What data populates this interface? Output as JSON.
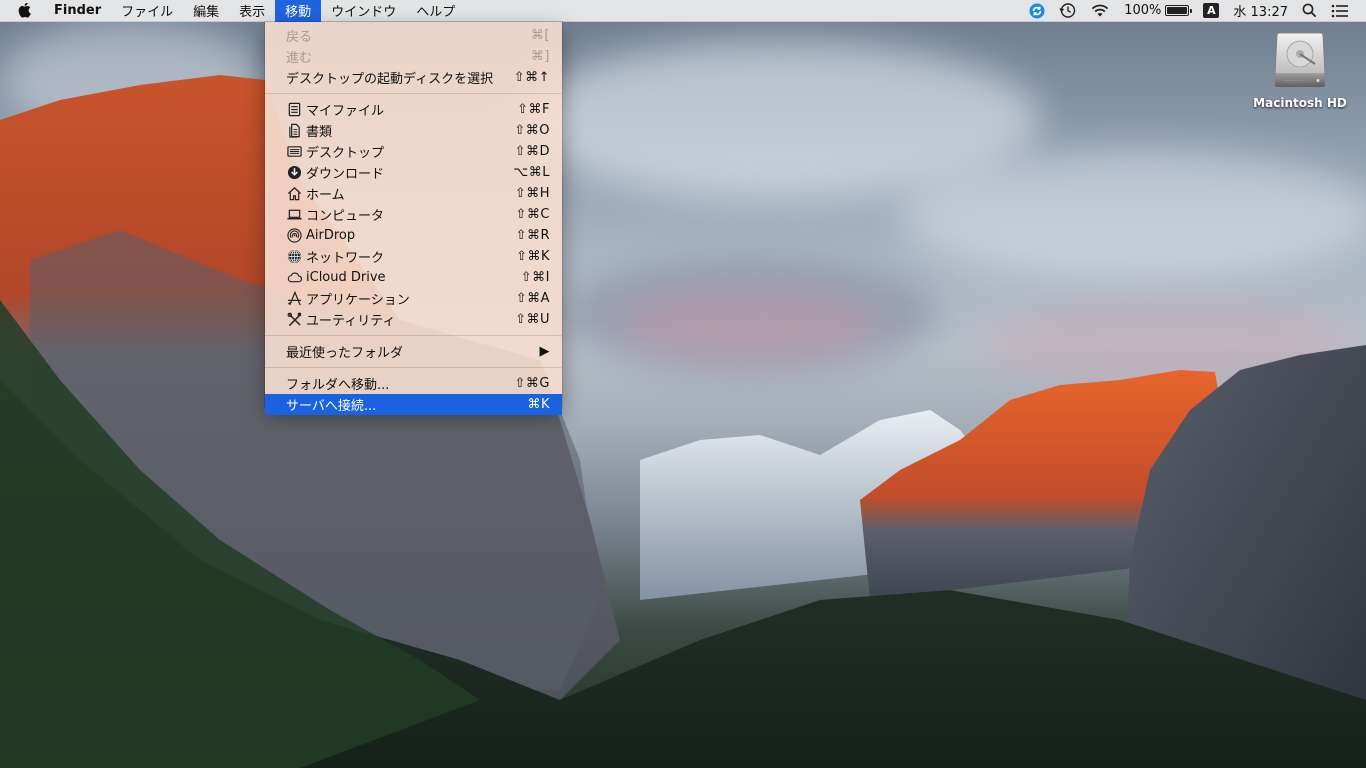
{
  "menubar": {
    "apple_icon": "apple-logo-icon",
    "app_name": "Finder",
    "menus": [
      {
        "label": "ファイル",
        "active": false
      },
      {
        "label": "編集",
        "active": false
      },
      {
        "label": "表示",
        "active": false
      },
      {
        "label": "移動",
        "active": true
      },
      {
        "label": "ウインドウ",
        "active": false
      },
      {
        "label": "ヘルプ",
        "active": false
      }
    ],
    "status": {
      "sync_icon": "sync-icon",
      "time_machine_icon": "time-machine-icon",
      "wifi_icon": "wifi-icon",
      "battery_percent_text": "100%",
      "battery_level": 1.0,
      "input_method": "A",
      "datetime": "水 13:27",
      "spotlight_icon": "spotlight-search-icon",
      "notification_icon": "notification-center-icon"
    }
  },
  "go_menu": {
    "items": [
      {
        "label": "戻る",
        "shortcut": "⌘[",
        "icon": null,
        "disabled": true
      },
      {
        "label": "進む",
        "shortcut": "⌘]",
        "icon": null,
        "disabled": true
      },
      {
        "label": "デスクトップの起動ディスクを選択",
        "shortcut": "⇧⌘↑",
        "icon": null,
        "disabled": false
      },
      {
        "separator": true
      },
      {
        "label": "マイファイル",
        "shortcut": "⇧⌘F",
        "icon": "all-my-files-icon"
      },
      {
        "label": "書類",
        "shortcut": "⇧⌘O",
        "icon": "documents-icon"
      },
      {
        "label": "デスクトップ",
        "shortcut": "⇧⌘D",
        "icon": "desktop-icon"
      },
      {
        "label": "ダウンロード",
        "shortcut": "⌥⌘L",
        "icon": "downloads-icon"
      },
      {
        "label": "ホーム",
        "shortcut": "⇧⌘H",
        "icon": "home-icon"
      },
      {
        "label": "コンピュータ",
        "shortcut": "⇧⌘C",
        "icon": "computer-icon"
      },
      {
        "label": "AirDrop",
        "shortcut": "⇧⌘R",
        "icon": "airdrop-icon"
      },
      {
        "label": "ネットワーク",
        "shortcut": "⇧⌘K",
        "icon": "network-icon"
      },
      {
        "label": "iCloud Drive",
        "shortcut": "⇧⌘I",
        "icon": "icloud-drive-icon"
      },
      {
        "label": "アプリケーション",
        "shortcut": "⇧⌘A",
        "icon": "applications-icon"
      },
      {
        "label": "ユーティリティ",
        "shortcut": "⇧⌘U",
        "icon": "utilities-icon"
      },
      {
        "separator": true
      },
      {
        "label": "最近使ったフォルダ",
        "shortcut": "▶",
        "icon": null,
        "submenu": true
      },
      {
        "separator": true
      },
      {
        "label": "フォルダへ移動...",
        "shortcut": "⇧⌘G",
        "icon": null
      },
      {
        "label": "サーバへ接続...",
        "shortcut": "⌘K",
        "icon": null,
        "highlighted": true
      }
    ]
  },
  "desktop": {
    "icons": [
      {
        "label": "Macintosh HD",
        "icon": "hard-drive-icon"
      }
    ]
  },
  "colors": {
    "menu_highlight": "#1a62e0",
    "menubar_bg": "#ececec",
    "menu_bg": "#f7ded0"
  }
}
